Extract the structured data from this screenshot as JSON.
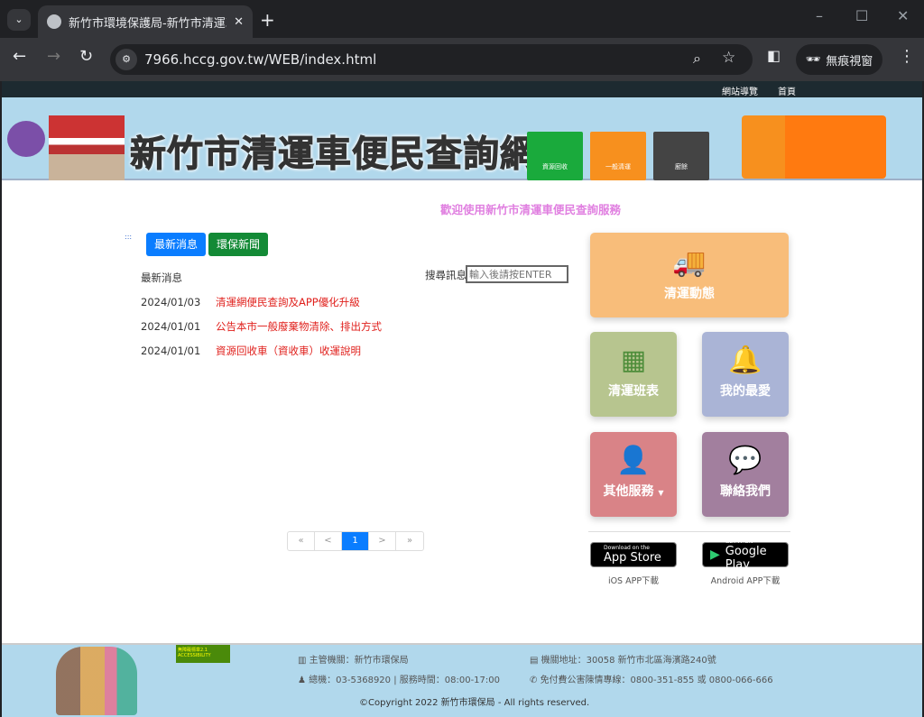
{
  "browser": {
    "tab_title": "新竹市環境保護局-新竹市清運車",
    "url": "7966.hccg.gov.tw/WEB/index.html",
    "incognito_label": "無痕視窗"
  },
  "topbar": {
    "sitemap": "網站導覽",
    "home": "首頁"
  },
  "banner": {
    "title": "新竹市清運車便民查詢網",
    "bins": [
      "資源回收",
      "一般清運",
      "廚餘"
    ],
    "bin_colors": [
      "#1aaa3c",
      "#f7901e",
      "#444444"
    ]
  },
  "welcome": "歡迎使用新竹市清運車便民查詢服務",
  "news_tabs": [
    {
      "label": "最新消息",
      "color": "#0a7dff"
    },
    {
      "label": "環保新聞",
      "color": "#138a36"
    }
  ],
  "news": {
    "heading": "最新消息",
    "search_label": "搜尋訊息:",
    "search_placeholder": "輸入後請按ENTER",
    "items": [
      {
        "date": "2024/01/03",
        "title": "清運網便民查詢及APP優化升級"
      },
      {
        "date": "2024/01/01",
        "title": "公告本市一般廢棄物清除、排出方式"
      },
      {
        "date": "2024/01/01",
        "title": "資源回收車（資收車）收運說明"
      }
    ]
  },
  "pagination": {
    "first": "«",
    "prev": "<",
    "current": "1",
    "next": ">",
    "last": "»"
  },
  "tiles": [
    {
      "label": "清運動態",
      "icon": "truck-icon",
      "color": "#f8bd7a"
    },
    {
      "label": "清運班表",
      "icon": "calendar-icon",
      "color": "#b7c58f"
    },
    {
      "label": "我的最愛",
      "icon": "bell-icon",
      "color": "#aab4d6"
    },
    {
      "label": "其他服務",
      "icon": "person-icon",
      "color": "#d98387"
    },
    {
      "label": "聯絡我們",
      "icon": "chat-icon",
      "color": "#a27f9e"
    }
  ],
  "apps": {
    "ios_small": "Download on the",
    "ios_big": "App Store",
    "ios_caption": "iOS APP下載",
    "android_small": "GET IT ON",
    "android_big": "Google Play",
    "android_caption": "Android APP下載"
  },
  "footer": {
    "accessibility": "無障礙標章2.1 ACCESSIBILITY",
    "authority": "主管機關：新竹市環保局",
    "address": "機關地址：30058 新竹市北區海濱路240號",
    "phone": "總機：03-5368920 | 服務時間：08:00-17:00",
    "hotline": "免付費公害陳情專線：0800-351-855 或 0800-066-666",
    "copyright": "©Copyright 2022 新竹市環保局 - All rights reserved."
  }
}
